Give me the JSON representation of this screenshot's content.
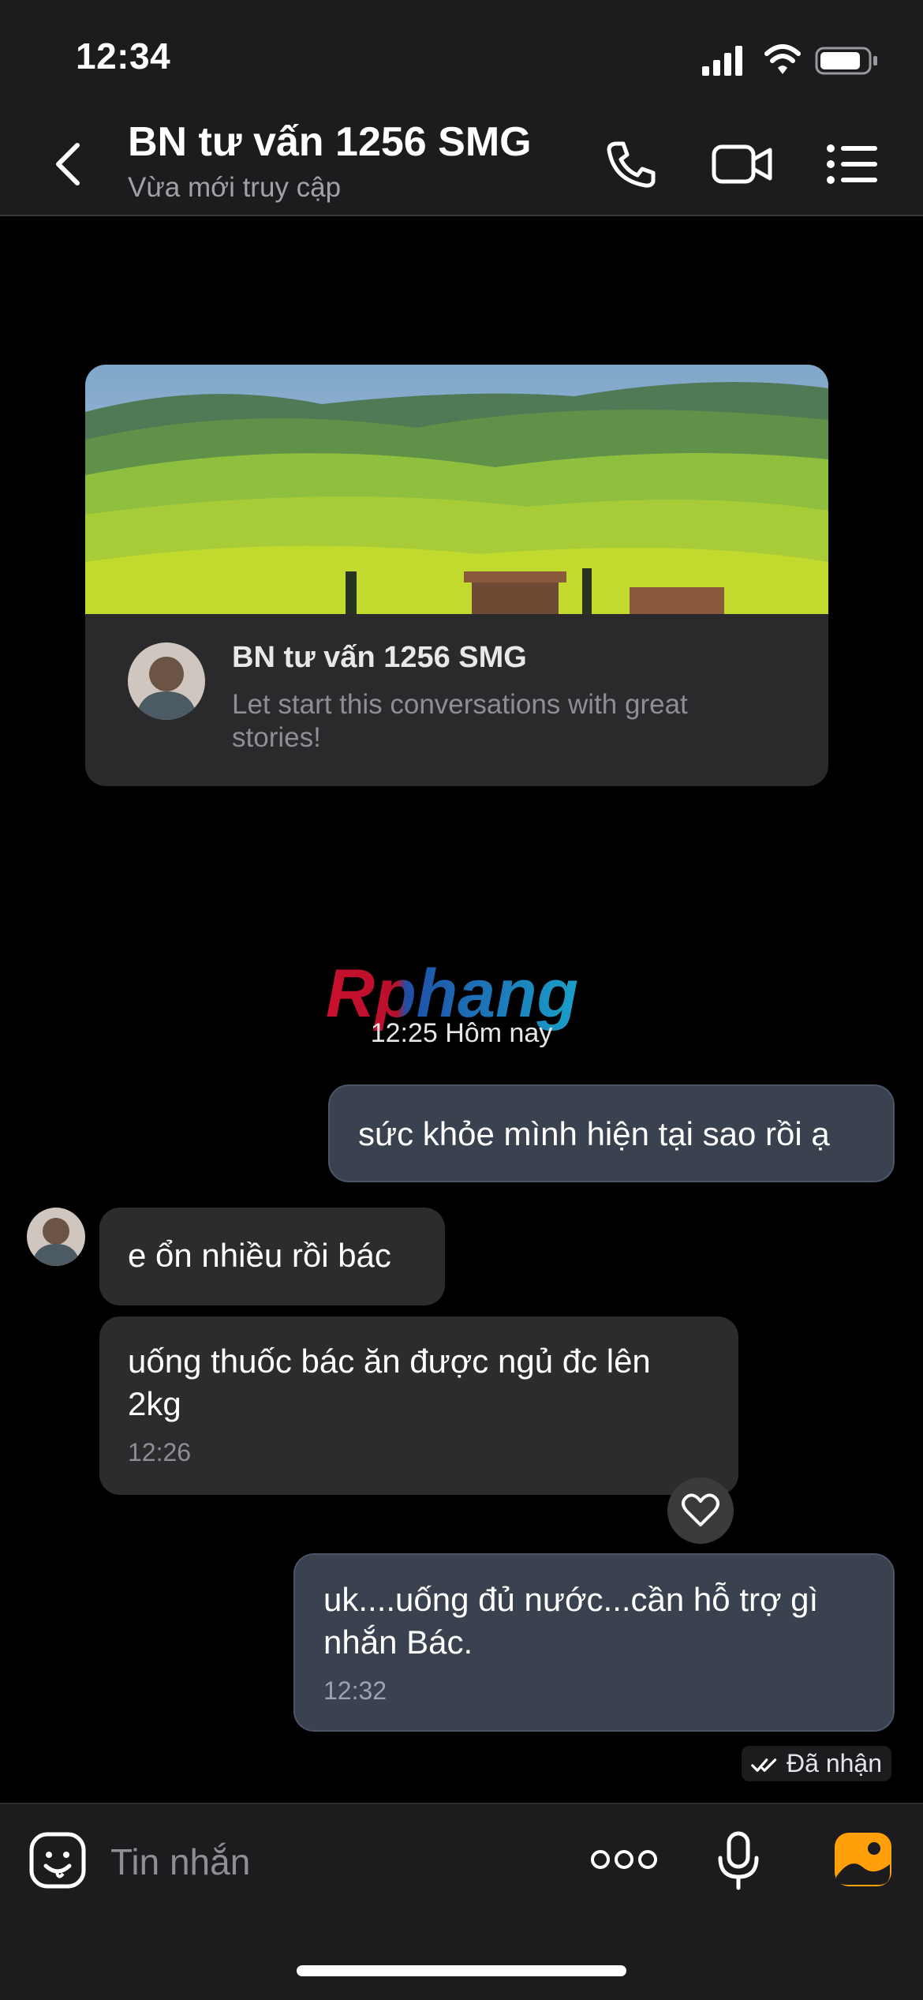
{
  "status_bar": {
    "time": "12:34",
    "icons": [
      "signal-icon",
      "wifi-icon",
      "battery-icon"
    ]
  },
  "header": {
    "title": "BN tư vấn 1256 SMG",
    "subtitle": "Vừa mới truy cập",
    "icons": [
      "back-icon",
      "phone-icon",
      "video-icon",
      "menu-icon"
    ]
  },
  "intro_card": {
    "name": "BN tư vấn 1256 SMG",
    "description": "Let start this conversations with great stories!"
  },
  "watermark": "Rphang",
  "date_separator": "12:25 Hôm nay",
  "messages": [
    {
      "direction": "out",
      "text": "sức khỏe mình hiện tại sao rồi ạ",
      "time": ""
    },
    {
      "direction": "in",
      "text": "e ổn nhiều rồi bác",
      "time": ""
    },
    {
      "direction": "in",
      "text": "uống thuốc bác ăn được ngủ đc lên 2kg",
      "time": "12:26"
    },
    {
      "direction": "out",
      "text": "uk....uống đủ nước...cần hỗ trợ gì nhắn Bác.",
      "time": "12:32"
    }
  ],
  "delivery_status": "Đã nhận",
  "composer": {
    "placeholder": "Tin nhắn",
    "icons": [
      "sticker-icon",
      "more-icon",
      "microphone-icon",
      "photo-icon"
    ]
  },
  "colors": {
    "background": "#000000",
    "bar": "#1c1c1e",
    "outgoing_bubble": "#3a4250",
    "incoming_bubble": "#2c2c2e",
    "photo_accent": "#ff9f0a"
  }
}
